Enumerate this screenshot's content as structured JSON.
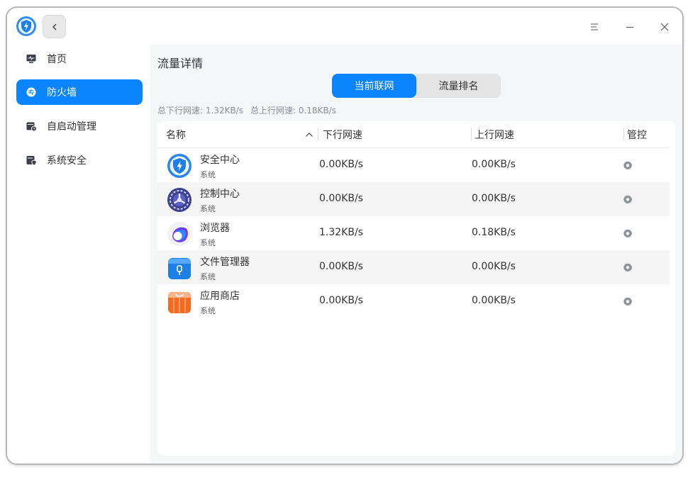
{
  "window": {
    "menu_icon": "menu-icon",
    "minimize_icon": "minimize-icon",
    "close_icon": "close-icon"
  },
  "sidebar": {
    "items": [
      {
        "label": "首页",
        "icon": "home-monitor-icon",
        "active": false
      },
      {
        "label": "防火墙",
        "icon": "firewall-icon",
        "active": true
      },
      {
        "label": "自启动管理",
        "icon": "startup-icon",
        "active": false
      },
      {
        "label": "系统安全",
        "icon": "system-security-icon",
        "active": false
      }
    ]
  },
  "main": {
    "title": "流量详情",
    "tabs": [
      {
        "label": "当前联网",
        "active": true
      },
      {
        "label": "流量排名",
        "active": false
      }
    ],
    "total_down": "总下行网速: 1.32KB/s",
    "total_up": "总上行网速: 0.18KB/s",
    "table": {
      "columns": [
        "名称",
        "下行网速",
        "上行网速",
        "管控"
      ],
      "sort_indicator": "^",
      "rows": [
        {
          "name": "安全中心",
          "type": "系统",
          "down": "0.00KB/s",
          "up": "0.00KB/s",
          "icon": "security-center-icon"
        },
        {
          "name": "控制中心",
          "type": "系统",
          "down": "0.00KB/s",
          "up": "0.00KB/s",
          "icon": "control-center-icon"
        },
        {
          "name": "浏览器",
          "type": "系统",
          "down": "1.32KB/s",
          "up": "0.18KB/s",
          "icon": "browser-icon"
        },
        {
          "name": "文件管理器",
          "type": "系统",
          "down": "0.00KB/s",
          "up": "0.00KB/s",
          "icon": "file-manager-icon"
        },
        {
          "name": "应用商店",
          "type": "系统",
          "down": "0.00KB/s",
          "up": "0.00KB/s",
          "icon": "app-store-icon"
        }
      ]
    }
  },
  "colors": {
    "accent": "#0a84ff",
    "muted_text": "#8a8f99"
  }
}
